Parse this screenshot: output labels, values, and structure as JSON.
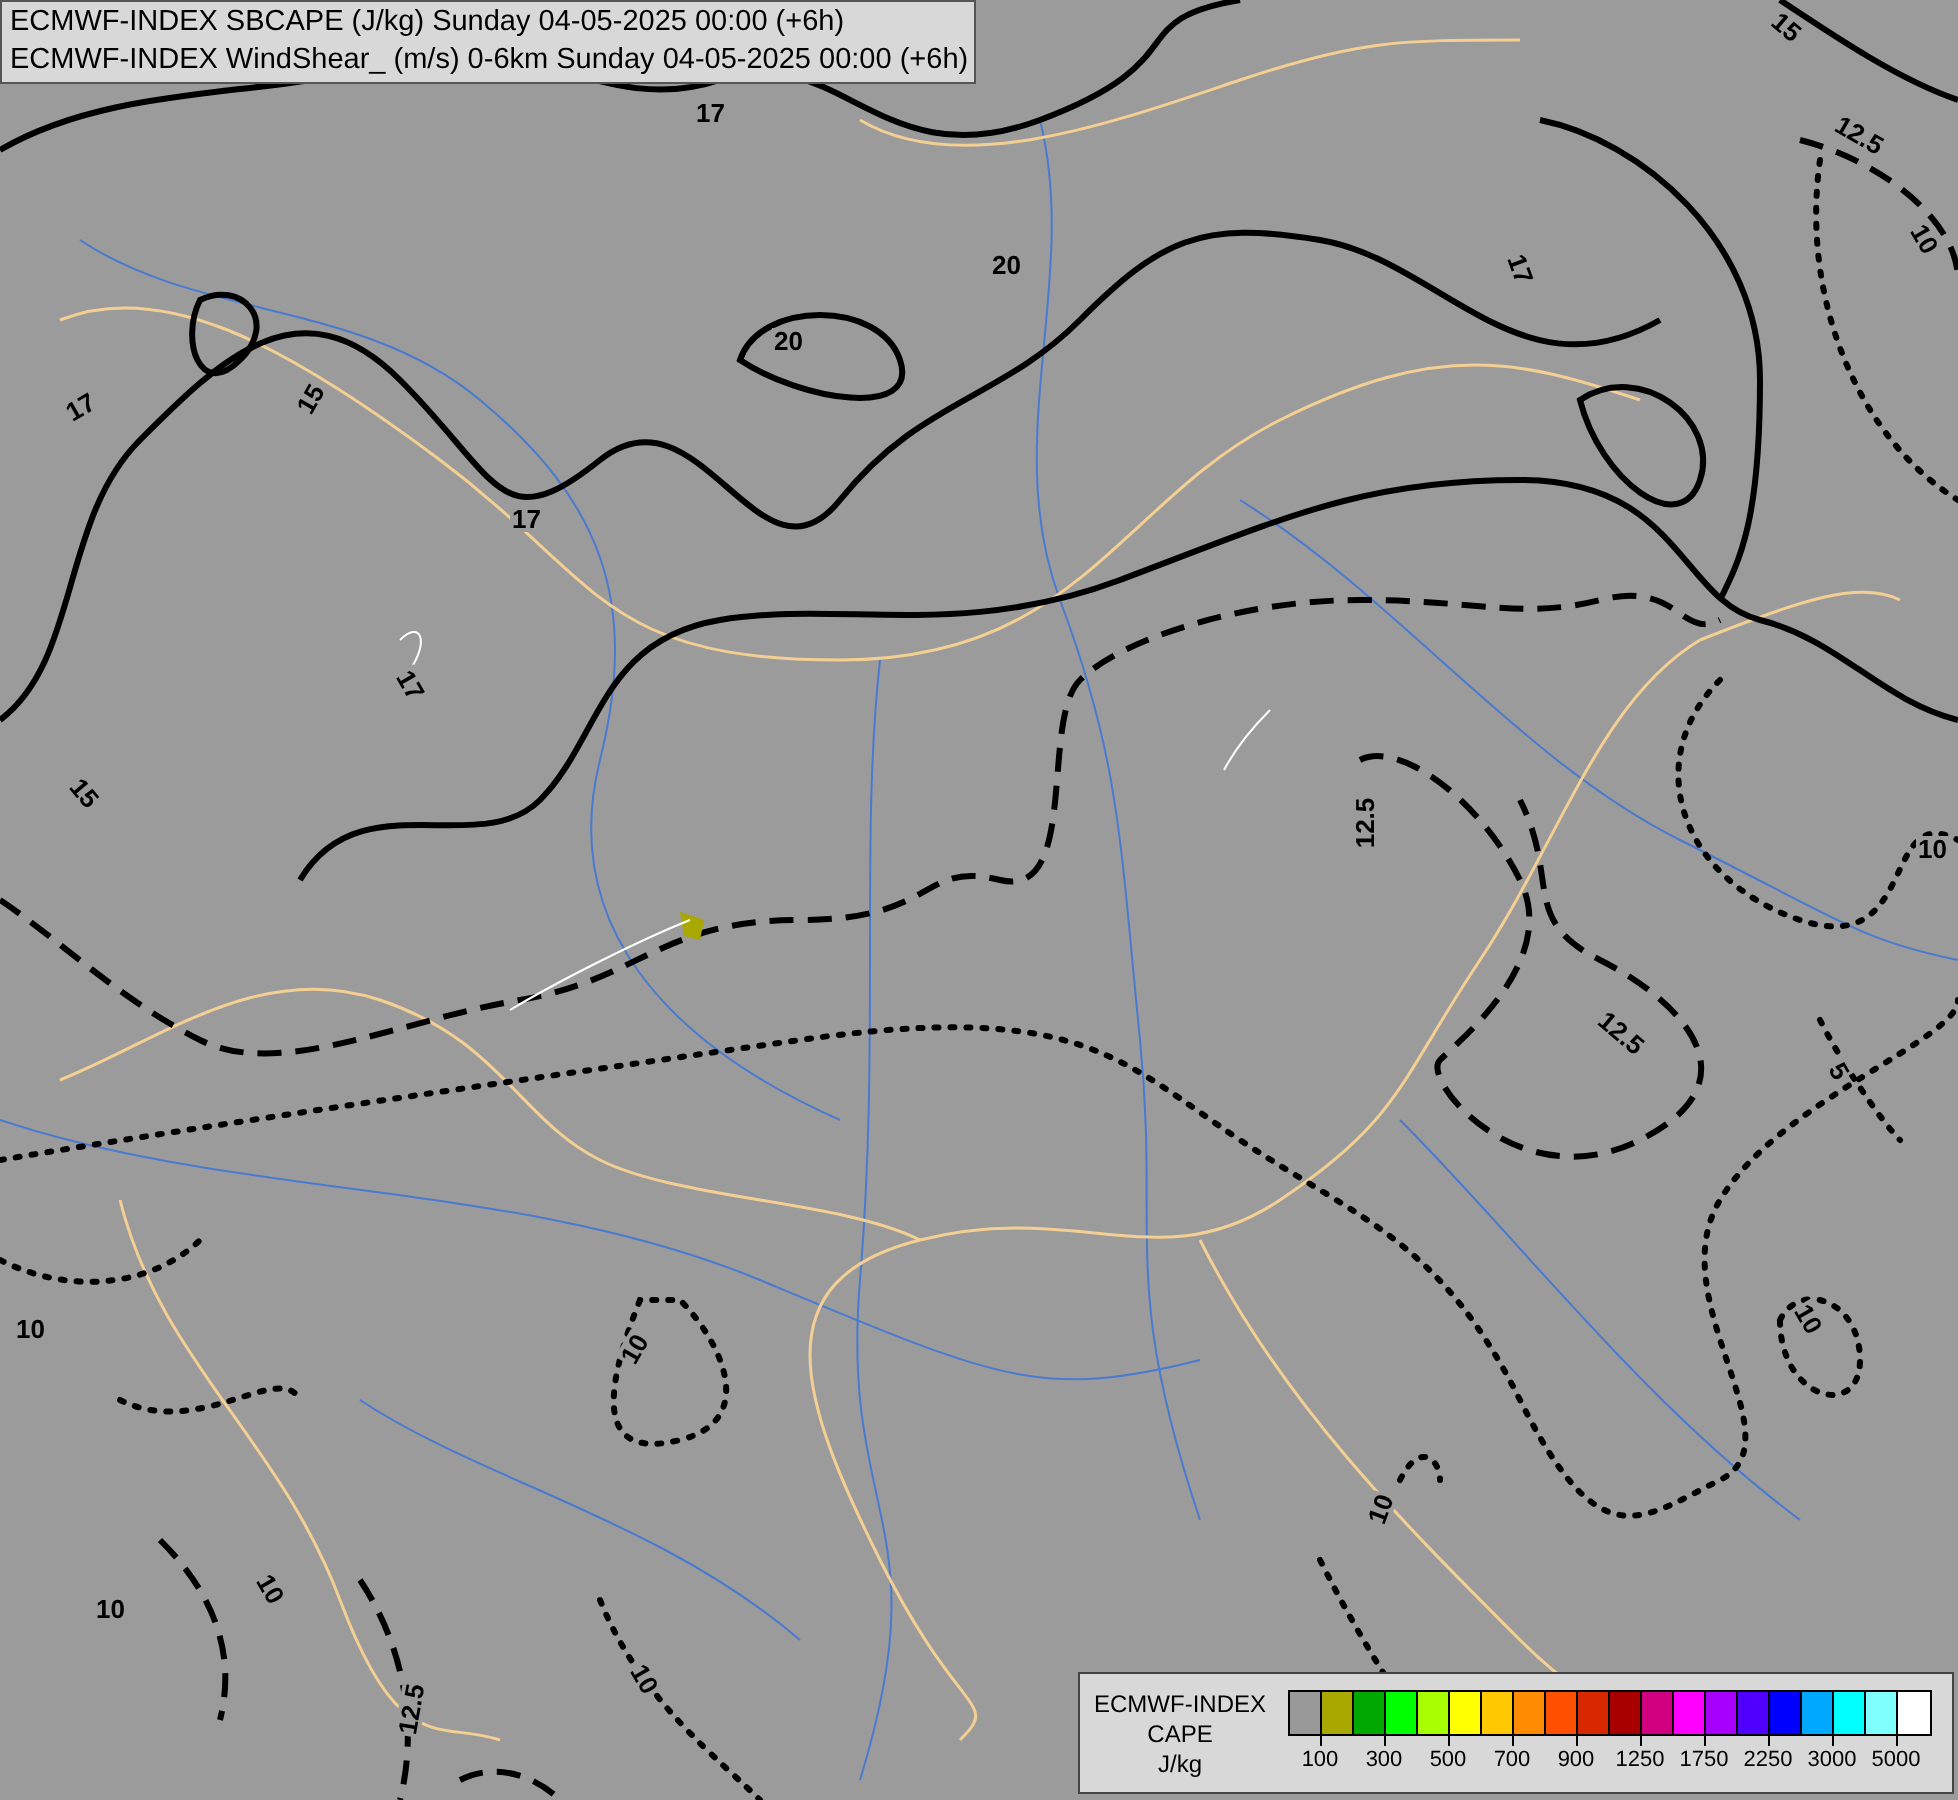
{
  "title_lines": [
    "ECMWF-INDEX SBCAPE (J/kg) Sunday 04-05-2025 00:00 (+6h)",
    "ECMWF-INDEX WindShear_ (m/s) 0-6km Sunday 04-05-2025 00:00 (+6h)"
  ],
  "contour_labels": [
    "17",
    "15",
    "12.5",
    "10",
    "20",
    "20",
    "17",
    "15",
    "17",
    "17",
    "17",
    "15",
    "12.5",
    "10",
    "12.5",
    "5",
    "10",
    "10",
    "10",
    "10",
    "10",
    "10",
    "12.5",
    "10"
  ],
  "legend": {
    "title_lines": [
      "ECMWF-INDEX",
      "CAPE",
      "J/kg"
    ],
    "scale": [
      {
        "color": "#999999"
      },
      {
        "color": "#a8a800"
      },
      {
        "color": "#00a800"
      },
      {
        "color": "#00ff00"
      },
      {
        "color": "#a8ff00"
      },
      {
        "color": "#ffff00"
      },
      {
        "color": "#ffc800"
      },
      {
        "color": "#ff8c00"
      },
      {
        "color": "#ff5000"
      },
      {
        "color": "#d82800"
      },
      {
        "color": "#a80000"
      },
      {
        "color": "#d00080"
      },
      {
        "color": "#ff00ff"
      },
      {
        "color": "#a800ff"
      },
      {
        "color": "#5000ff"
      },
      {
        "color": "#0000ff"
      },
      {
        "color": "#00a8ff"
      },
      {
        "color": "#00ffff"
      },
      {
        "color": "#80ffff"
      },
      {
        "color": "#ffffff"
      }
    ],
    "ticks": [
      "100",
      "300",
      "500",
      "700",
      "900",
      "1250",
      "1750",
      "2250",
      "3000",
      "5000"
    ]
  }
}
